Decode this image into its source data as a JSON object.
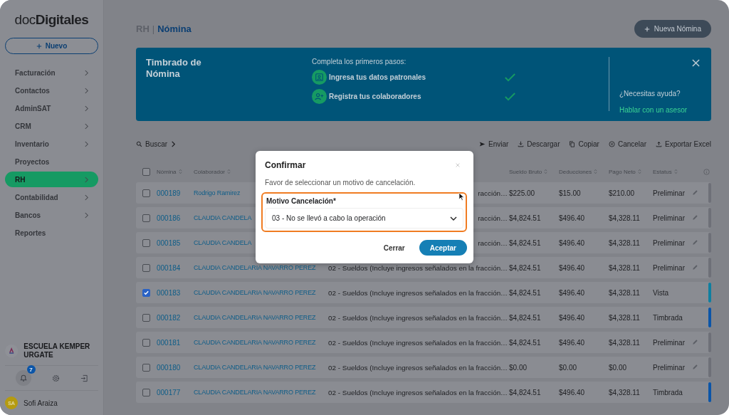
{
  "logo": "doc**Digitales**",
  "new_button": "Nuevo",
  "sidebar": {
    "items": [
      {
        "label": "Facturación",
        "selected": false,
        "expandable": true
      },
      {
        "label": "Contactos",
        "selected": false,
        "expandable": true
      },
      {
        "label": "AdminSAT",
        "selected": false,
        "expandable": true
      },
      {
        "label": "CRM",
        "selected": false,
        "expandable": true
      },
      {
        "label": "Inventario",
        "selected": false,
        "expandable": true
      },
      {
        "label": "Proyectos",
        "selected": false,
        "expandable": false
      },
      {
        "label": "RH",
        "selected": true,
        "expandable": true
      },
      {
        "label": "Contabilidad",
        "selected": false,
        "expandable": true
      },
      {
        "label": "Bancos",
        "selected": false,
        "expandable": true
      },
      {
        "label": "Reportes",
        "selected": false,
        "expandable": false
      }
    ],
    "organization": "ESCUELA KEMPER URGATE",
    "notification_count": "7",
    "user_initials": "SA",
    "user_name": "Sofi Araiza"
  },
  "header": {
    "section": "RH",
    "separator": "|",
    "page": "Nómina",
    "new_button": "Nueva Nómina"
  },
  "banner": {
    "title": "Timbrado de Nómina",
    "intro": "Completa los primeros pasos:",
    "steps": [
      {
        "kind": "company",
        "label": "Ingresa tus datos patronales",
        "done": true
      },
      {
        "kind": "people",
        "label": "Registra tus colaboradores",
        "done": true
      }
    ],
    "help": "¿Necesitas ayuda?",
    "help_link": "Hablar con un asesor"
  },
  "toolbar": {
    "search": "Buscar",
    "actions": [
      {
        "kind": "send",
        "label": "Enviar"
      },
      {
        "kind": "download",
        "label": "Descargar"
      },
      {
        "kind": "copy",
        "label": "Copiar"
      },
      {
        "kind": "cancel",
        "label": "Cancelar"
      },
      {
        "kind": "export",
        "label": "Exportar Excel"
      }
    ]
  },
  "table": {
    "all_selected": false,
    "columns": [
      "Nómina",
      "Colaborador",
      "Sueldo Bruto",
      "Deducciones",
      "Pago Neto",
      "Estatus"
    ],
    "rows": [
      {
        "selected": false,
        "id": "000189",
        "name": "Rodrigo Ramirez",
        "concept": "racción…",
        "gross": "$225.00",
        "deductions": "$15.00",
        "net": "$210.00",
        "status": "Preliminar",
        "editable": true,
        "color": "#6e7078"
      },
      {
        "selected": false,
        "id": "000186",
        "name": "CLAUDIA CANDELA",
        "concept": "racción…",
        "gross": "$4,824.51",
        "deductions": "$496.40",
        "net": "$4,328.11",
        "status": "Preliminar",
        "editable": true,
        "color": "#6e7078"
      },
      {
        "selected": false,
        "id": "000185",
        "name": "CLAUDIA CANDELA",
        "concept": "racción…",
        "gross": "$4,824.51",
        "deductions": "$496.40",
        "net": "$4,328.11",
        "status": "Preliminar",
        "editable": true,
        "color": "#6e7078"
      },
      {
        "selected": false,
        "id": "000184",
        "name": "CLAUDIA CANDELARIA NAVARRO PEREZ",
        "concept": "02 - Sueldos (Incluye ingresos señalados en la fracción…",
        "gross": "$4,824.51",
        "deductions": "$496.40",
        "net": "$4,328.11",
        "status": "Preliminar",
        "editable": true,
        "color": "#6e7078"
      },
      {
        "selected": true,
        "id": "000183",
        "name": "CLAUDIA CANDELARIA NAVARRO PEREZ",
        "concept": "02 - Sueldos (Incluye ingresos señalados en la fracción…",
        "gross": "$4,824.51",
        "deductions": "$496.40",
        "net": "$4,328.11",
        "status": "Vista",
        "editable": false,
        "color": "#0f7fa0"
      },
      {
        "selected": false,
        "id": "000182",
        "name": "CLAUDIA CANDELARIA NAVARRO PEREZ",
        "concept": "02 - Sueldos (Incluye ingresos señalados en la fracción…",
        "gross": "$4,824.51",
        "deductions": "$496.40",
        "net": "$4,328.11",
        "status": "Timbrada",
        "editable": false,
        "color": "#0b55a8"
      },
      {
        "selected": false,
        "id": "000181",
        "name": "CLAUDIA CANDELARIA NAVARRO PEREZ",
        "concept": "02 - Sueldos (Incluye ingresos señalados en la fracción…",
        "gross": "$4,824.51",
        "deductions": "$496.40",
        "net": "$4,328.11",
        "status": "Preliminar",
        "editable": true,
        "color": "#6e7078"
      },
      {
        "selected": false,
        "id": "000180",
        "name": "CLAUDIA CANDELARIA NAVARRO PEREZ",
        "concept": "02 - Sueldos (Incluye ingresos señalados en la fracción…",
        "gross": "$0.00",
        "deductions": "$0.00",
        "net": "$0.00",
        "status": "Preliminar",
        "editable": true,
        "color": "#6e7078"
      },
      {
        "selected": false,
        "id": "000177",
        "name": "CLAUDIA CANDELARIA NAVARRO PEREZ",
        "concept": "02 - Sueldos (Incluye ingresos señalados en la fracción…",
        "gross": "$4,824.51",
        "deductions": "$496.40",
        "net": "$4,328.11",
        "status": "Timbrada",
        "editable": false,
        "color": "#0b55a8"
      }
    ]
  },
  "dialog": {
    "title": "Confirmar",
    "message": "Favor de seleccionar un motivo de cancelación.",
    "field_label": "Motivo Cancelación*",
    "field_value": "03 - No se llevó a cabo la operación",
    "buttons": [
      {
        "kind": "secondary",
        "label": "Cerrar"
      },
      {
        "kind": "primary",
        "label": "Aceptar"
      }
    ]
  }
}
